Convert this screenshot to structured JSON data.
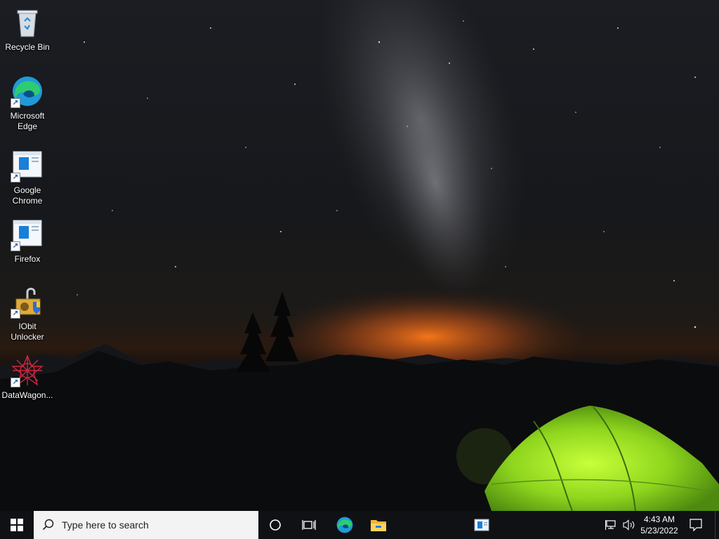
{
  "desktop": {
    "icons": [
      {
        "label": "Recycle Bin",
        "icon": "recycle-bin-icon"
      },
      {
        "label": "Microsoft Edge",
        "icon": "edge-icon"
      },
      {
        "label": "Google Chrome",
        "icon": "app-window-icon"
      },
      {
        "label": "Firefox",
        "icon": "app-window-icon"
      },
      {
        "label": "IObit Unlocker",
        "icon": "iobit-unlocker-icon"
      },
      {
        "label": "DataWagon...",
        "icon": "datawagon-icon"
      }
    ]
  },
  "taskbar": {
    "search_placeholder": "Type here to search",
    "pinned": [
      "start-icon",
      "cortana-icon",
      "task-view-icon",
      "edge-icon",
      "file-explorer-icon",
      "app-window-icon"
    ],
    "clock_time": "4:43 AM",
    "clock_date": "5/23/2022"
  },
  "colors": {
    "taskbar_bg": "#101114",
    "windows_blue": "#0078d7",
    "tent_green": "#9be22a"
  }
}
